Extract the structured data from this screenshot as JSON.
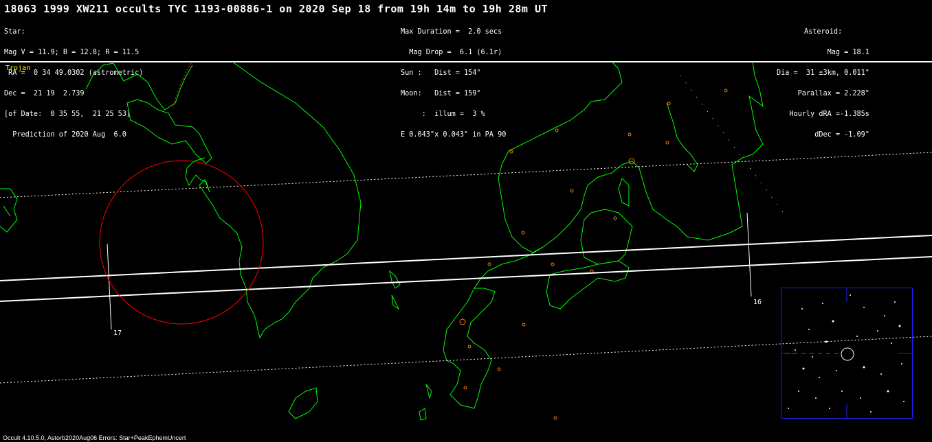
{
  "header": {
    "title": "18063 1999 XW211 occults TYC 1193-00886-1 on 2020 Sep 18 from 19h 14m to 19h 28m UT",
    "star": [
      "Star:",
      "Mag V = 11.9; B = 12.8; R = 11.5",
      " RA =  0 34 49.0302 (astrometric)",
      "Dec =  21 19  2.739",
      "[of Date:  0 35 55,  21 25 53]",
      "  Prediction of 2020 Aug  6.0"
    ],
    "event": [
      "Max Duration =  2.0 secs",
      "  Mag Drop =  6.1 (6.1r)",
      "Sun :   Dist = 154°",
      "Moon:   Dist = 159°",
      "     :  illum =  3 %",
      "E 0.043\"x 0.043\" in PA 90"
    ],
    "asteroid": [
      "Asteroid:",
      "Mag = 18.1",
      "Dia =  31 ±3km, 0.011\"",
      "Parallax = 2.228\"",
      "Hourly dRA =-1.385s",
      "dDec = -1.09\""
    ]
  },
  "map": {
    "category": "Trojan",
    "time_labels": [
      "17",
      "16"
    ],
    "colors": {
      "coast": "#00ff00",
      "path": "#ffffff",
      "uncertainty": "#ffffff",
      "circle": "#ff0000",
      "cities": "#ff8000",
      "category": "#ffff00",
      "inset_border": "#2020ff"
    }
  },
  "footer": "Occult 4.10.5.0, Astorb2020Aug06  Errors: Star+PeakEphemUncert"
}
